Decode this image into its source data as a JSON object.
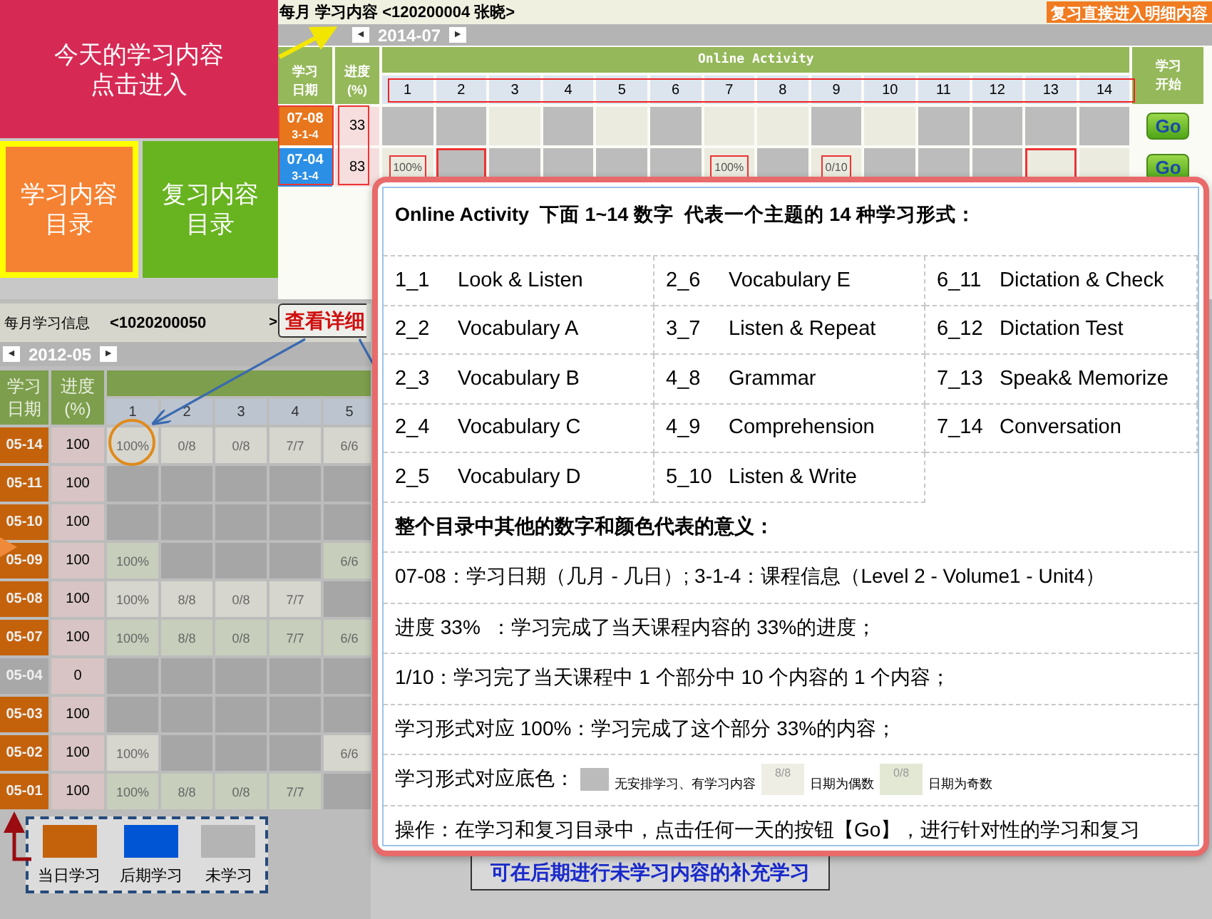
{
  "tiles": [
    {
      "lines": [
        "今天的学习内容",
        "点击进入"
      ],
      "kind": "today",
      "selected": false
    },
    {
      "lines": [
        "学习内容",
        "目录"
      ],
      "kind": "study",
      "selected": true
    },
    {
      "lines": [
        "复习内容",
        "目录"
      ],
      "kind": "review",
      "selected": false
    }
  ],
  "monthly_panel": {
    "title": "每月 学习内容 <120200004 张晓>",
    "review_button": "复习直接进入明细内容",
    "prev": "◄",
    "month": "2014-07",
    "next": "►",
    "columns": {
      "date": "学习日期",
      "progress": "进度 (%)",
      "activity": "Online Activity",
      "days": [
        "1",
        "2",
        "3",
        "4",
        "5",
        "6",
        "7",
        "8",
        "9",
        "10",
        "11",
        "12",
        "13",
        "14"
      ],
      "start": "学习开始"
    },
    "days_marked": true,
    "dates_marked": true,
    "progress_marked": true,
    "rows": [
      {
        "date": "07-08",
        "course": "3-1-4",
        "color": "#e8761c",
        "progress": "33",
        "button": "Go",
        "cells": [
          {
            "kind": "none"
          },
          {
            "kind": "none"
          },
          {
            "kind": "even"
          },
          {
            "kind": "none"
          },
          {
            "kind": "even"
          },
          {
            "kind": "none"
          },
          {
            "kind": "even"
          },
          {
            "kind": "even"
          },
          {
            "kind": "none"
          },
          {
            "kind": "even"
          },
          {
            "kind": "none"
          },
          {
            "kind": "none"
          },
          {
            "kind": "none"
          },
          {
            "kind": "none"
          }
        ]
      },
      {
        "date": "07-04",
        "course": "3-1-4",
        "color": "#2b8fe6",
        "progress": "83",
        "button": "Go",
        "cells": [
          {
            "kind": "even",
            "text": "100%",
            "marked": true
          },
          {
            "kind": "none",
            "marked": true
          },
          {
            "kind": "none"
          },
          {
            "kind": "none"
          },
          {
            "kind": "none"
          },
          {
            "kind": "none"
          },
          {
            "kind": "even",
            "text": "100%",
            "marked": true
          },
          {
            "kind": "none"
          },
          {
            "kind": "even",
            "text": "0/10",
            "marked": true
          },
          {
            "kind": "none"
          },
          {
            "kind": "none"
          },
          {
            "kind": "none"
          },
          {
            "kind": "even",
            "marked": true
          },
          {
            "kind": "even"
          }
        ]
      }
    ]
  },
  "info_panel": {
    "title": "每月学习信息",
    "student": "<1020200050",
    "next": ">",
    "callout": "查看详细",
    "prev_month": "◄",
    "month": "2012-05",
    "next_month": "►",
    "columns": {
      "date": "学习日期",
      "progress": "进度 (%)",
      "days": [
        "1",
        "2",
        "3",
        "4",
        "5"
      ]
    },
    "rows": [
      {
        "date": "05-14",
        "color": "#c4620c",
        "progress": "100",
        "cells": [
          {
            "kind": "even",
            "text": "100%",
            "circled": true
          },
          {
            "kind": "even",
            "text": "0/8"
          },
          {
            "kind": "even",
            "text": "0/8"
          },
          {
            "kind": "even",
            "text": "7/7"
          },
          {
            "kind": "even",
            "text": "6/6"
          }
        ]
      },
      {
        "date": "05-11",
        "color": "#c4620c",
        "progress": "100",
        "cells": [
          {
            "kind": "none"
          },
          {
            "kind": "none"
          },
          {
            "kind": "none"
          },
          {
            "kind": "none"
          },
          {
            "kind": "none"
          }
        ]
      },
      {
        "date": "05-10",
        "color": "#c4620c",
        "progress": "100",
        "cells": [
          {
            "kind": "none"
          },
          {
            "kind": "none"
          },
          {
            "kind": "none"
          },
          {
            "kind": "none"
          },
          {
            "kind": "none"
          }
        ]
      },
      {
        "date": "05-09",
        "color": "#c4620c",
        "progress": "100",
        "cells": [
          {
            "kind": "odd",
            "text": "100%"
          },
          {
            "kind": "none"
          },
          {
            "kind": "none"
          },
          {
            "kind": "none"
          },
          {
            "kind": "odd",
            "text": "6/6"
          }
        ]
      },
      {
        "date": "05-08",
        "color": "#c4620c",
        "progress": "100",
        "cells": [
          {
            "kind": "even",
            "text": "100%"
          },
          {
            "kind": "even",
            "text": "8/8"
          },
          {
            "kind": "even",
            "text": "0/8"
          },
          {
            "kind": "even",
            "text": "7/7"
          },
          {
            "kind": "none"
          }
        ]
      },
      {
        "date": "05-07",
        "color": "#c4620c",
        "progress": "100",
        "cells": [
          {
            "kind": "odd",
            "text": "100%"
          },
          {
            "kind": "odd",
            "text": "8/8"
          },
          {
            "kind": "odd",
            "text": "0/8"
          },
          {
            "kind": "odd",
            "text": "7/7"
          },
          {
            "kind": "odd",
            "text": "6/6"
          }
        ]
      },
      {
        "date": "05-04",
        "color": "#a8a8a8",
        "progress": "0",
        "cells": [
          {
            "kind": "none"
          },
          {
            "kind": "none"
          },
          {
            "kind": "none"
          },
          {
            "kind": "none"
          },
          {
            "kind": "none"
          }
        ]
      },
      {
        "date": "05-03",
        "color": "#c4620c",
        "progress": "100",
        "cells": [
          {
            "kind": "none"
          },
          {
            "kind": "none"
          },
          {
            "kind": "none"
          },
          {
            "kind": "none"
          },
          {
            "kind": "none"
          }
        ]
      },
      {
        "date": "05-02",
        "color": "#c4620c",
        "progress": "100",
        "cells": [
          {
            "kind": "even",
            "text": "100%"
          },
          {
            "kind": "none"
          },
          {
            "kind": "none"
          },
          {
            "kind": "none"
          },
          {
            "kind": "even",
            "text": "6/6"
          }
        ]
      },
      {
        "date": "05-01",
        "color": "#c4620c",
        "progress": "100",
        "cells": [
          {
            "kind": "odd",
            "text": "100%"
          },
          {
            "kind": "odd",
            "text": "8/8"
          },
          {
            "kind": "odd",
            "text": "0/8"
          },
          {
            "kind": "odd",
            "text": "7/7"
          },
          {
            "kind": "none"
          }
        ]
      }
    ],
    "legend": [
      {
        "label": "当日学习",
        "color": "#c4620c"
      },
      {
        "label": "后期学习",
        "color": "#0055d4"
      },
      {
        "label": "未学习",
        "color": "#b4b4b4"
      }
    ]
  },
  "popup": {
    "title": "Online Activity  下面 1~14 数字  代表一个主题的 14 种学习形式：",
    "activities": [
      {
        "code": "1_1",
        "name": "Look & Listen"
      },
      {
        "code": "2_2",
        "name": "Vocabulary A"
      },
      {
        "code": "2_3",
        "name": "Vocabulary B"
      },
      {
        "code": "2_4",
        "name": "Vocabulary C"
      },
      {
        "code": "2_5",
        "name": "Vocabulary D"
      },
      {
        "code": "2_6",
        "name": "Vocabulary E"
      },
      {
        "code": "3_7",
        "name": "Listen & Repeat"
      },
      {
        "code": "4_8",
        "name": "Grammar"
      },
      {
        "code": "4_9",
        "name": "Comprehension"
      },
      {
        "code": "5_10",
        "name": "Listen & Write"
      },
      {
        "code": "6_11",
        "name": "Dictation & Check"
      },
      {
        "code": "6_12",
        "name": "Dictation Test"
      },
      {
        "code": "7_13",
        "name": "Speak& Memorize"
      },
      {
        "code": "7_14",
        "name": "Conversation"
      }
    ],
    "notes": [
      {
        "kind": "heading",
        "text": "整个目录中其他的数字和颜色代表的意义："
      },
      {
        "kind": "text",
        "text": "07-08：学习日期（几月 - 几日）; 3-1-4：课程信息（Level 2 - Volume1 - Unit4）"
      },
      {
        "kind": "text",
        "text": "进度 33%  ：学习完成了当天课程内容的 33%的进度；"
      },
      {
        "kind": "text",
        "text": "1/10：学习完了当天课程中 1 个部分中 10 个内容的 1 个内容；"
      },
      {
        "kind": "text",
        "text": "学习形式对应 100%：学习完成了这个部分 33%的内容；"
      },
      {
        "kind": "colors",
        "parts": [
          {
            "kind": "label",
            "text": "学习形式对应底色："
          },
          {
            "kind": "swatch",
            "color": "#bbbbbb"
          },
          {
            "kind": "caption",
            "text": "无安排学习、有学习内容"
          },
          {
            "kind": "swatch",
            "color": "#eeeee4",
            "text": "8/8"
          },
          {
            "kind": "caption",
            "text": "日期为偶数"
          },
          {
            "kind": "swatch",
            "color": "#e2e8d4",
            "text": "0/8"
          },
          {
            "kind": "caption",
            "text": "日期为奇数"
          }
        ]
      },
      {
        "kind": "text",
        "text": "操作：在学习和复习目录中，点击任何一天的按钮【Go】，进行针对性的学习和复习"
      }
    ]
  },
  "supplement_button": "可在后期进行未学习内容的补充学习"
}
